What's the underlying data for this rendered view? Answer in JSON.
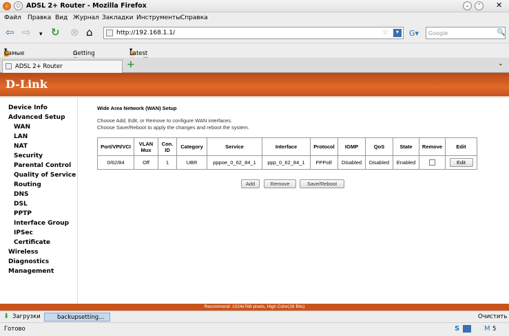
{
  "window": {
    "title": "ADSL 2+ Router - Mozilla Firefox"
  },
  "menu": [
    "Файл",
    "Правка",
    "Вид",
    "Журнал",
    "Закладки",
    "Инструменты",
    "Справка"
  ],
  "nav": {
    "url": "http://192.168.1.1/",
    "search_placeholder": "Google"
  },
  "bookmarks": [
    "Самые попул...",
    "Getting Started",
    "Latest Headli..."
  ],
  "tab": {
    "label": "ADSL 2+ Router"
  },
  "brand": {
    "logo": "D-Link"
  },
  "sidebar": [
    {
      "label": "Device Info",
      "level": 0
    },
    {
      "label": "Advanced Setup",
      "level": 0
    },
    {
      "label": "WAN",
      "level": 1
    },
    {
      "label": "LAN",
      "level": 1
    },
    {
      "label": "NAT",
      "level": 1
    },
    {
      "label": "Security",
      "level": 1
    },
    {
      "label": "Parental Control",
      "level": 1
    },
    {
      "label": "Quality of Service",
      "level": 1
    },
    {
      "label": "Routing",
      "level": 1
    },
    {
      "label": "DNS",
      "level": 1
    },
    {
      "label": "DSL",
      "level": 1
    },
    {
      "label": "PPTP",
      "level": 1
    },
    {
      "label": "Interface Group",
      "level": 1
    },
    {
      "label": "IPSec",
      "level": 1
    },
    {
      "label": "Certificate",
      "level": 1
    },
    {
      "label": "Wireless",
      "level": 0
    },
    {
      "label": "Diagnostics",
      "level": 0
    },
    {
      "label": "Management",
      "level": 0
    }
  ],
  "main": {
    "title": "Wide Area Network (WAN) Setup",
    "desc1": "Choose Add, Edit, or Remove to configure WAN interfaces.",
    "desc2": "Choose Save/Reboot to apply the changes and reboot the system.",
    "columns": [
      "Port/VPI/VCI",
      "VLAN Mux",
      "Con. ID",
      "Category",
      "Service",
      "Interface",
      "Protocol",
      "IGMP",
      "QoS",
      "State",
      "Remove",
      "Edit"
    ],
    "row": {
      "port": "0/62/84",
      "vlan": "Off",
      "conid": "1",
      "category": "UBR",
      "service": "pppoe_0_62_84_1",
      "interface": "ppp_0_62_84_1",
      "protocol": "PPPoE",
      "igmp": "Disabled",
      "qos": "Disabled",
      "state": "Enabled",
      "remove_checked": false,
      "edit_label": "Edit"
    },
    "buttons": {
      "add": "Add",
      "remove": "Remove",
      "save": "Save/Reboot"
    }
  },
  "footer": {
    "recommend": "Recommend: 1024x768 pixels, High Color(16 Bits)"
  },
  "downloads": {
    "label": "Загрузки",
    "item": "backupsetting...",
    "clear": "Очистить"
  },
  "status": {
    "text": "Готово",
    "mail_count": "5"
  },
  "colors": {
    "brand_orange": "#e06a2a",
    "footer_orange": "#c8541c"
  }
}
